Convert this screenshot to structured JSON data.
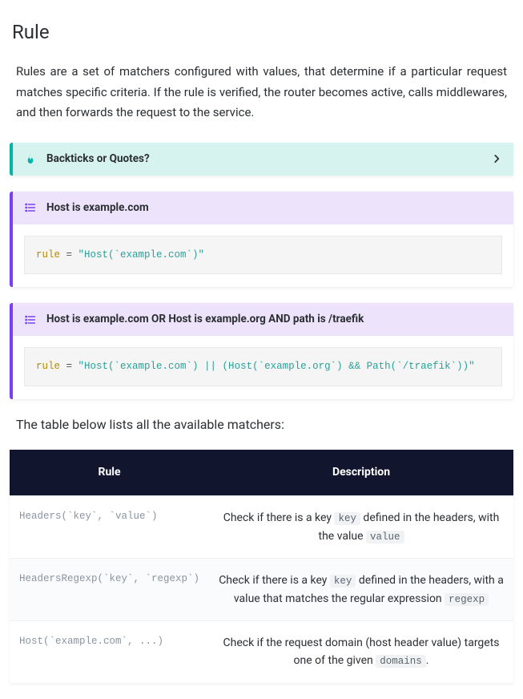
{
  "heading": "Rule",
  "intro": "Rules are a set of matchers configured with values, that determine if a particular request matches specific criteria. If the rule is verified, the router becomes active, calls middlewares, and then forwards the request to the service.",
  "tip": {
    "title": "Backticks or Quotes?"
  },
  "example1": {
    "title": "Host is example.com",
    "code_key": "rule",
    "code_op": " = ",
    "code_str": "\"Host(`example.com`)\""
  },
  "example2": {
    "title": "Host is example.com OR Host is example.org AND path is /traefik",
    "code_key": "rule",
    "code_op": " = ",
    "code_str": "\"Host(`example.com`) || (Host(`example.org`) && Path(`/traefik`))\""
  },
  "table_lead": "The table below lists all the available matchers:",
  "table": {
    "headers": {
      "rule": "Rule",
      "desc": "Description"
    },
    "rows": [
      {
        "rule": "Headers(`key`, `value`)",
        "desc_pre": "Check if there is a key ",
        "code1": "key",
        "desc_mid": " defined in the headers, with the value ",
        "code2": "value",
        "desc_post": ""
      },
      {
        "rule": "HeadersRegexp(`key`, `regexp`)",
        "desc_pre": "Check if there is a key ",
        "code1": "key",
        "desc_mid": " defined in the headers, with a value that matches the regular expression ",
        "code2": "regexp",
        "desc_post": ""
      },
      {
        "rule": "Host(`example.com`, ...)",
        "desc_pre": "Check if the request domain (host header value) targets one of the given ",
        "code1": "domains",
        "desc_mid": "",
        "code2": "",
        "desc_post": "."
      }
    ]
  }
}
